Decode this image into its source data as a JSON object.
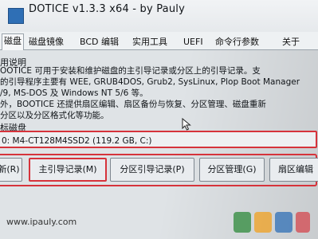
{
  "window": {
    "title": "DOTICE v1.3.3 x64 - by Pauly"
  },
  "tabs": [
    {
      "label": "磁盘"
    },
    {
      "label": "磁盘镜像"
    },
    {
      "label": "BCD 编辑"
    },
    {
      "label": "实用工具"
    },
    {
      "label": "UEFI"
    },
    {
      "label": "命令行参数"
    },
    {
      "label": "关于"
    }
  ],
  "description": {
    "label": "用说明",
    "lines": [
      "OOTICE 可用于安装和维护磁盘的主引导记录或分区上的引导记录。支",
      "的引导程序主要有 WEE, GRUB4DOS, Grub2, SysLinux, Plop Boot Manager",
      "/9, MS-DOS 及 Windows NT 5/6 等。",
      "外，BOOTICE 还提供扇区编辑、扇区备份与恢复、分区管理、磁盘重新",
      "分区以及分区格式化等功能。"
    ]
  },
  "target_disk": {
    "label": "标磁盘",
    "selected": "0: M4-CT128M4SSD2 (119.2 GB, C:)"
  },
  "buttons": {
    "refresh": "新(R)",
    "mbr": "主引导记录(M)",
    "pbr": "分区引导记录(P)",
    "partition": "分区管理(G)",
    "sector": "扇区编辑"
  },
  "footer": {
    "url": "www.ipauly.com"
  },
  "colors": {
    "highlight": "#d6333b",
    "accent": "#2f6fb5"
  }
}
